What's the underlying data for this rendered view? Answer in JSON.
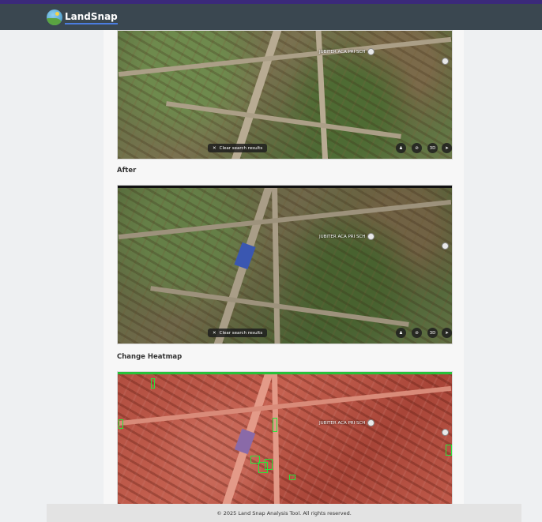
{
  "app": {
    "name": "LandSnap"
  },
  "sections": {
    "before": {
      "poi": "JUBITER ACA PRI SCH",
      "clear": "Clear search results",
      "ctrl3d": "3D"
    },
    "after": {
      "label": "After",
      "poi": "JUBITER ACA PRI SCH",
      "clear": "Clear search results",
      "ctrl3d": "3D"
    },
    "heatmap": {
      "label": "Change Heatmap",
      "poi": "JUBITER ACA PRI SCH"
    }
  },
  "footer": {
    "text": "© 2025 Land Snap Analysis Tool. All rights reserved."
  },
  "colors": {
    "navbar": "#3a4750",
    "accent": "#3b2a7a",
    "change_box": "#27e53a"
  }
}
